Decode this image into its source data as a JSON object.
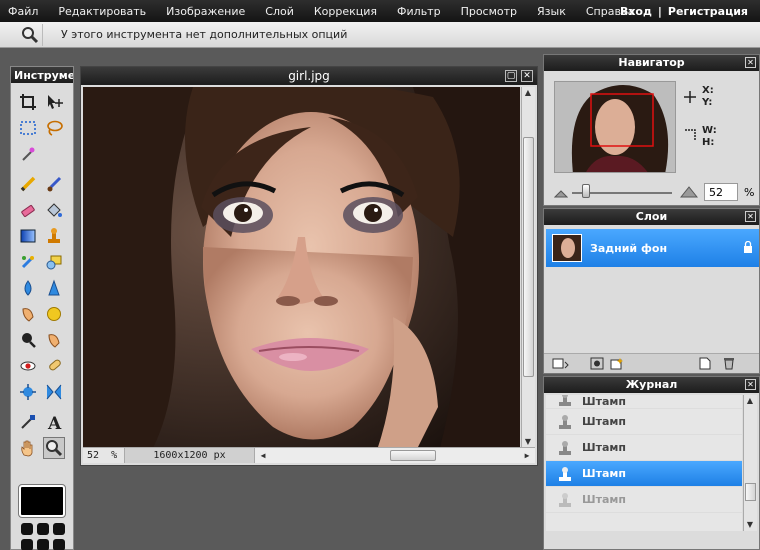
{
  "menubar": {
    "items": [
      "Файл",
      "Редактировать",
      "Изображение",
      "Слой",
      "Коррекция",
      "Фильтр",
      "Просмотр",
      "Язык",
      "Справка"
    ],
    "login": "Вход",
    "separator": "|",
    "register": "Регистрация"
  },
  "optionsbar": {
    "text": "У этого инструмента нет дополнительных опций"
  },
  "tools": {
    "title": "Инструменты",
    "primary_color": "#000000"
  },
  "image_window": {
    "title": "girl.jpg",
    "zoom": "52",
    "zoom_unit": "%",
    "dimensions": "1600x1200 px"
  },
  "navigator": {
    "title": "Навигатор",
    "x_label": "X:",
    "y_label": "Y:",
    "w_label": "W:",
    "h_label": "H:",
    "zoom": "52",
    "zoom_unit": "%"
  },
  "layers": {
    "title": "Слои",
    "items": [
      {
        "name": "Задний фон"
      }
    ]
  },
  "history": {
    "title": "Журнал",
    "items": [
      {
        "label": "Штамп"
      },
      {
        "label": "Штамп"
      },
      {
        "label": "Штамп"
      },
      {
        "label": "Штамп"
      },
      {
        "label": "Штамп"
      }
    ]
  },
  "colors": {
    "accent": "#2b8ef0",
    "titlebar": "#1c1c1c"
  }
}
